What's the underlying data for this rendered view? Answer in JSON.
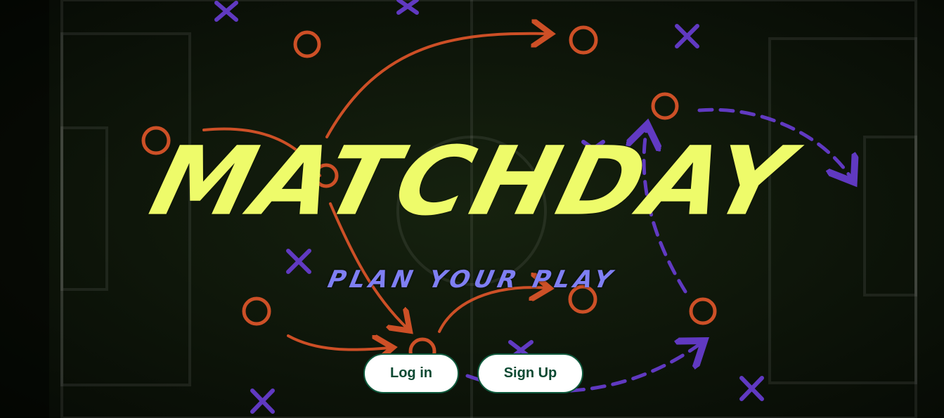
{
  "hero": {
    "title": "MATCHDAY",
    "subtitle": "PLAN YOUR PLAY"
  },
  "buttons": {
    "login_label": "Log in",
    "signup_label": "Sign Up"
  },
  "colors": {
    "title": "#eefb6a",
    "subtitle": "#7f7ff3",
    "button_text": "#0d4a33",
    "orange_marks": "#e2562a",
    "purple_marks": "#6a3ed6",
    "pitch": "#0b1208"
  }
}
